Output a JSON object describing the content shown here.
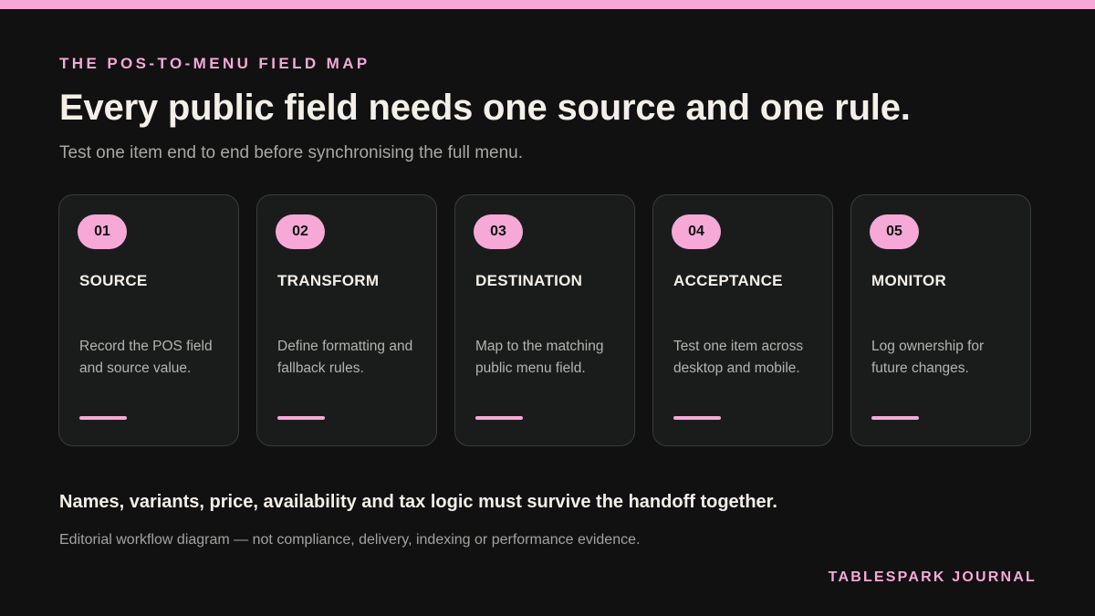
{
  "eyebrow": "THE POS-TO-MENU FIELD MAP",
  "headline": "Every public field needs one source and one rule.",
  "subhead": "Test one item end to end before synchronising the full menu.",
  "steps": [
    {
      "number": "01",
      "title": "SOURCE",
      "description": "Record the POS field and source value."
    },
    {
      "number": "02",
      "title": "TRANSFORM",
      "description": "Define formatting and fallback rules."
    },
    {
      "number": "03",
      "title": "DESTINATION",
      "description": "Map to the matching public menu field."
    },
    {
      "number": "04",
      "title": "ACCEPTANCE",
      "description": "Test one item across desktop and mobile."
    },
    {
      "number": "05",
      "title": "MONITOR",
      "description": "Log ownership for future changes."
    }
  ],
  "takeaway": "Names, variants, price, availability and tax logic must survive the handoff together.",
  "disclaimer": "Editorial workflow diagram — not compliance, delivery, indexing or performance evidence.",
  "brand": "TABLESPARK JOURNAL",
  "colors": {
    "accent": "#f6a9d6",
    "background": "#111111",
    "card": "#1a1c1c",
    "card_border": "#3a3c3b",
    "text_primary": "#f4f0e8",
    "text_muted": "#a9a9a4"
  }
}
